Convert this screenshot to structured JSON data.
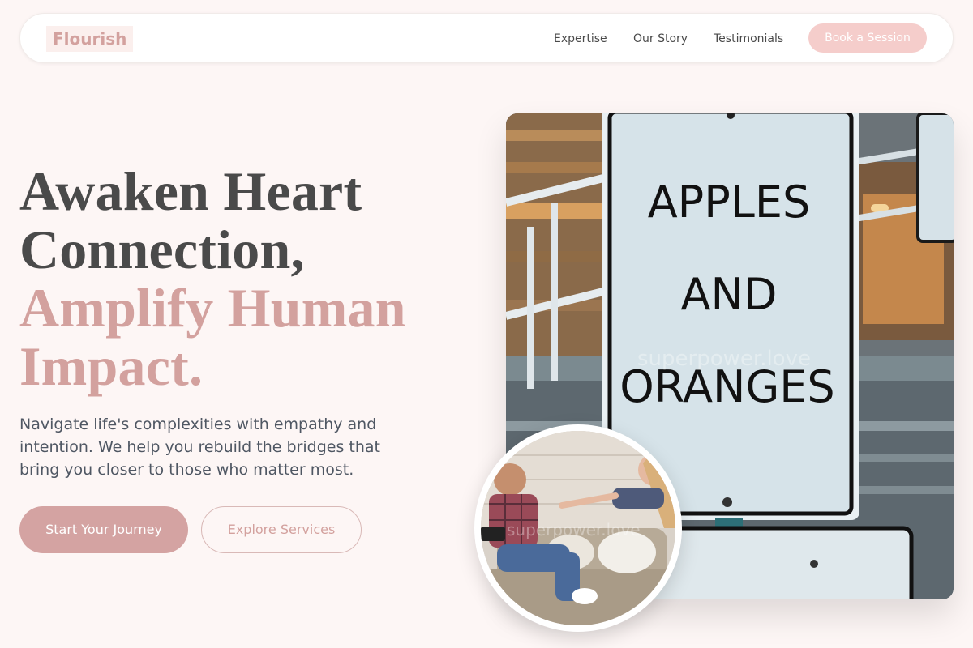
{
  "brand": {
    "name": "Flourish"
  },
  "nav": {
    "items": [
      {
        "label": "Expertise"
      },
      {
        "label": "Our Story"
      },
      {
        "label": "Testimonials"
      }
    ],
    "cta_label": "Book a Session"
  },
  "hero": {
    "headline_line1": "Awaken Heart",
    "headline_line2": "Connection,",
    "headline_accent1": "Amplify Human",
    "headline_accent2": "Impact.",
    "subtext": "Navigate life's complexities with empathy and intention. We help you rebuild the bridges that bring you closer to those who matter most.",
    "primary_cta": "Start Your Journey",
    "secondary_cta": "Explore Services"
  },
  "main_image": {
    "sign_line1": "APPLES",
    "sign_line2": "AND",
    "sign_line3": "ORANGES",
    "watermark": "superpower.love"
  },
  "circle_image": {
    "watermark": "superpower.love"
  },
  "colors": {
    "accent": "#d3a19e",
    "background": "#fdf6f5",
    "button_primary": "#d4a3a2",
    "button_book": "#f5cdcb"
  }
}
